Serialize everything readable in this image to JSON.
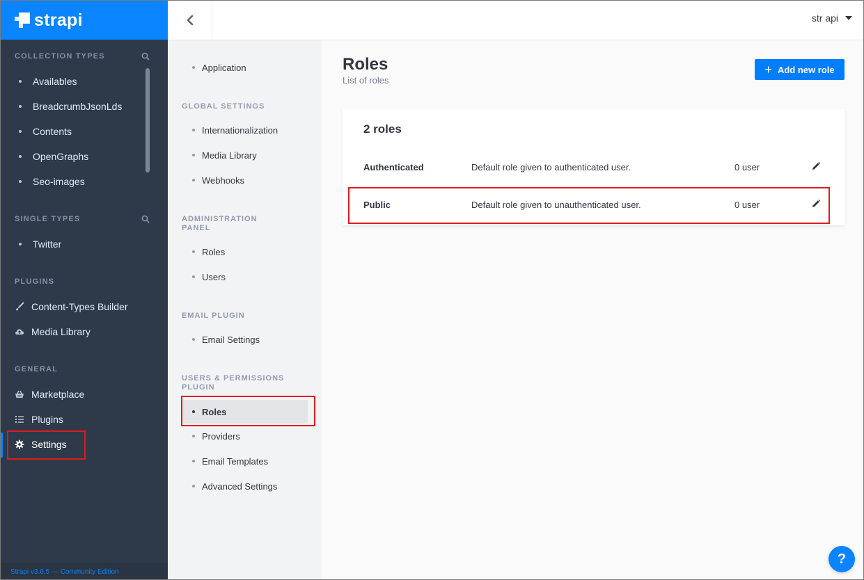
{
  "brand": {
    "logo_text": "strapi"
  },
  "leftnav": {
    "collection_types_title": "COLLECTION TYPES",
    "collection_types": [
      "Availables",
      "BreadcrumbJsonLds",
      "Contents",
      "OpenGraphs",
      "Seo-images"
    ],
    "single_types_title": "SINGLE TYPES",
    "single_types": [
      "Twitter"
    ],
    "plugins_title": "PLUGINS",
    "plugins": [
      {
        "label": "Content-Types Builder",
        "icon": "paintbrush-icon"
      },
      {
        "label": "Media Library",
        "icon": "cloud-upload-icon"
      }
    ],
    "general_title": "GENERAL",
    "general": [
      {
        "label": "Marketplace",
        "icon": "basket-icon"
      },
      {
        "label": "Plugins",
        "icon": "list-icon"
      },
      {
        "label": "Settings",
        "icon": "gear-icon",
        "active": true
      }
    ],
    "footer": "Strapi v3.6.5 — Community Edition"
  },
  "header": {
    "user_name": "str api"
  },
  "subnav": {
    "application": "Application",
    "global_settings_title": "GLOBAL SETTINGS",
    "global_settings": [
      "Internationalization",
      "Media Library",
      "Webhooks"
    ],
    "admin_panel_title": "ADMINISTRATION PANEL",
    "admin_panel": [
      "Roles",
      "Users"
    ],
    "email_plugin_title": "EMAIL PLUGIN",
    "email_plugin": [
      "Email Settings"
    ],
    "users_permissions_title": "USERS & PERMISSIONS PLUGIN",
    "users_permissions": [
      "Roles",
      "Providers",
      "Email Templates",
      "Advanced Settings"
    ],
    "active_item": "Roles"
  },
  "main": {
    "title": "Roles",
    "subtitle": "List of roles",
    "add_button": "Add new role",
    "card_title": "2 roles",
    "roles": [
      {
        "name": "Authenticated",
        "description": "Default role given to authenticated user.",
        "count": "0 user"
      },
      {
        "name": "Public",
        "description": "Default role given to unauthenticated user.",
        "count": "0 user"
      }
    ]
  },
  "help_button": "?",
  "colors": {
    "brand_blue": "#0a84ff",
    "sidebar_dark": "#2e3a4a",
    "highlight_red": "#e01b1b"
  }
}
